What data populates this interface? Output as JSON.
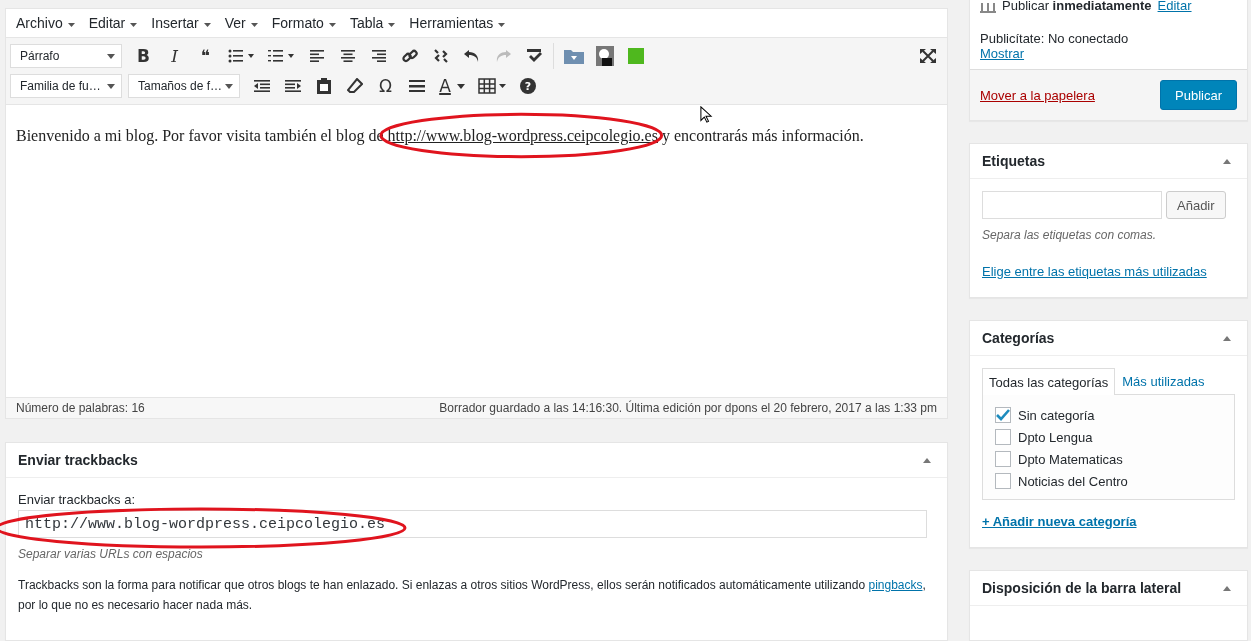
{
  "editor": {
    "menu": [
      {
        "label": "Archivo"
      },
      {
        "label": "Editar"
      },
      {
        "label": "Insertar"
      },
      {
        "label": "Ver"
      },
      {
        "label": "Formato"
      },
      {
        "label": "Tabla"
      },
      {
        "label": "Herramientas"
      }
    ],
    "format_select": "Párrafo",
    "font_family_select": "Familia de fu…",
    "font_size_select": "Tamaños de f…",
    "glyphs": {
      "bold": "B",
      "italic": "I",
      "quote": "❝",
      "omega": "Ω",
      "text_color": "A",
      "help": "?"
    },
    "content": {
      "before": "Bienvenido a mi blog. Por favor visita también el blog de ",
      "link": "http://www.blog-wordpress.ceipcolegio.es",
      "after": " y encontrarás más información."
    },
    "word_count": "Número de palabras: 16",
    "draft_status": "Borrador guardado a las 14:16:30. Última edición por dpons el 20 febrero, 2017 a las 1:33 pm"
  },
  "trackbacks": {
    "title": "Enviar trackbacks",
    "field_label": "Enviar trackbacks a:",
    "value": "http://www.blog-wordpress.ceipcolegio.es",
    "hint": "Separar varias URLs con espacios",
    "description_before": "Trackbacks son la forma para notificar que otros blogs te han enlazado. Si enlazas a otros sitios WordPress, ellos serán notificados automáticamente utilizando ",
    "description_link": "pingbacks",
    "description_after": ", por lo que no es necesario hacer nada más."
  },
  "publish": {
    "schedule": "Publicar **inmediatamente**",
    "schedule_edit": "Editar",
    "publicize": "Publicítate: No conectado",
    "publicize_link": "Mostrar",
    "trash": "Mover a la papelera",
    "publish_button": "Publicar"
  },
  "tags": {
    "title": "Etiquetas",
    "add_button": "Añadir",
    "hint": "Separa las etiquetas con comas.",
    "most_used_link": "Elige entre las etiquetas más utilizadas"
  },
  "categories": {
    "title": "Categorías",
    "tabs": [
      {
        "label": "Todas las categorías",
        "selected": true
      },
      {
        "label": "Más utilizadas",
        "selected": false
      }
    ],
    "items": [
      {
        "label": "Sin categoría",
        "checked": true
      },
      {
        "label": "Dpto Lengua",
        "checked": false
      },
      {
        "label": "Dpto Matematicas",
        "checked": false
      },
      {
        "label": "Noticias del Centro",
        "checked": false
      }
    ],
    "add_link": "+ Añadir nueva categoría"
  },
  "sidebar_layout": {
    "title": "Disposición de la barra lateral"
  }
}
